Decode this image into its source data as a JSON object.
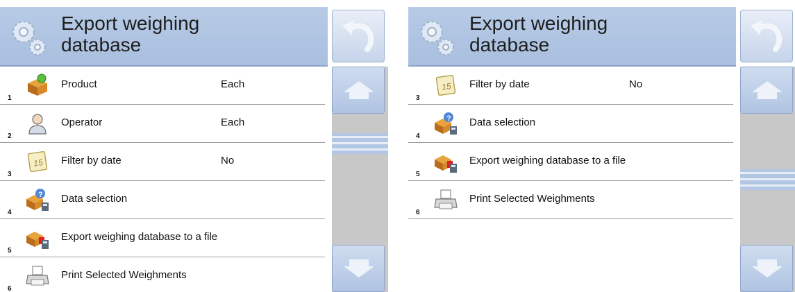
{
  "colors": {
    "header": "#b0c5e3",
    "scrollbar": "#c8c8c8",
    "buttons": "#bccde6"
  },
  "screens": [
    {
      "title": "Export weighing\ndatabase",
      "scroll_position": 0.15,
      "rows": [
        {
          "num": "1",
          "icon": "product-icon",
          "label": "Product",
          "value": "Each"
        },
        {
          "num": "2",
          "icon": "operator-icon",
          "label": "Operator",
          "value": "Each"
        },
        {
          "num": "3",
          "icon": "calendar-icon",
          "label": "Filter by date",
          "value": "No"
        },
        {
          "num": "4",
          "icon": "data-selection-icon",
          "label": "Data selection",
          "value": ""
        },
        {
          "num": "5",
          "icon": "export-database-icon",
          "label": "Export weighing database to a file",
          "value": ""
        },
        {
          "num": "6",
          "icon": "printer-icon",
          "label": "Print Selected Weighments",
          "value": ""
        }
      ]
    },
    {
      "title": "Export weighing\ndatabase",
      "scroll_position": 0.5,
      "rows": [
        {
          "num": "3",
          "icon": "calendar-icon",
          "label": "Filter by date",
          "value": "No"
        },
        {
          "num": "4",
          "icon": "data-selection-icon",
          "label": "Data selection",
          "value": ""
        },
        {
          "num": "5",
          "icon": "export-database-icon",
          "label": "Export weighing database to a file",
          "value": ""
        },
        {
          "num": "6",
          "icon": "printer-icon",
          "label": "Print Selected Weighments",
          "value": ""
        }
      ]
    }
  ]
}
